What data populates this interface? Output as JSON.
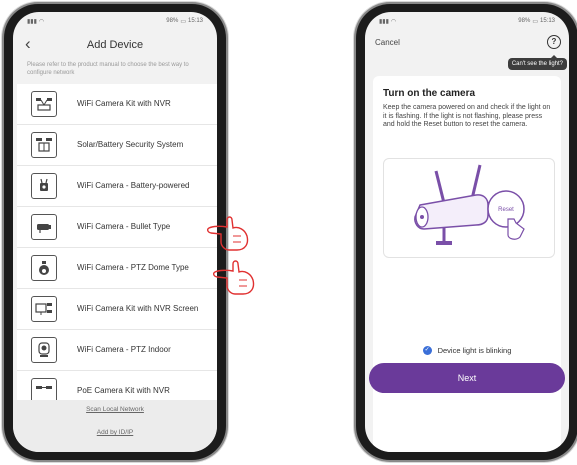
{
  "left_screen": {
    "status_right": "15:13",
    "battery": "98%",
    "title": "Add Device",
    "back_icon": "chevron-left-icon",
    "hint": "Please refer to the product manual to choose the best way to configure network",
    "items": [
      {
        "label": "WiFi Camera Kit with NVR",
        "icon": "nvr-kit-icon"
      },
      {
        "label": "Solar/Battery Security System",
        "icon": "solar-system-icon"
      },
      {
        "label": "WiFi Camera - Battery-powered",
        "icon": "battery-camera-icon"
      },
      {
        "label": "WiFi Camera - Bullet Type",
        "icon": "bullet-camera-icon"
      },
      {
        "label": "WiFi Camera - PTZ Dome Type",
        "icon": "dome-camera-icon"
      },
      {
        "label": "WiFi Camera Kit with NVR Screen",
        "icon": "nvr-screen-icon"
      },
      {
        "label": "WiFi Camera - PTZ Indoor",
        "icon": "indoor-camera-icon"
      },
      {
        "label": "PoE Camera Kit with NVR",
        "icon": "poe-kit-icon"
      }
    ],
    "scan_link": "Scan Local Network",
    "add_link": "Add by ID/IP"
  },
  "right_screen": {
    "status_right": "15:13",
    "battery": "98%",
    "cancel": "Cancel",
    "help_glyph": "?",
    "tooltip": "Can't see the light?",
    "heading": "Turn on the camera",
    "description": "Keep the camera powered on and check if the light on it is flashing. If the light is not flashing, please press and hold the Reset button to reset the camera.",
    "reset_label": "Reset",
    "check_label": "Device light is blinking",
    "next_button": "Next"
  },
  "colors": {
    "accent": "#6a3a9a",
    "check": "#3b6fd8",
    "annotation": "#e03030"
  }
}
